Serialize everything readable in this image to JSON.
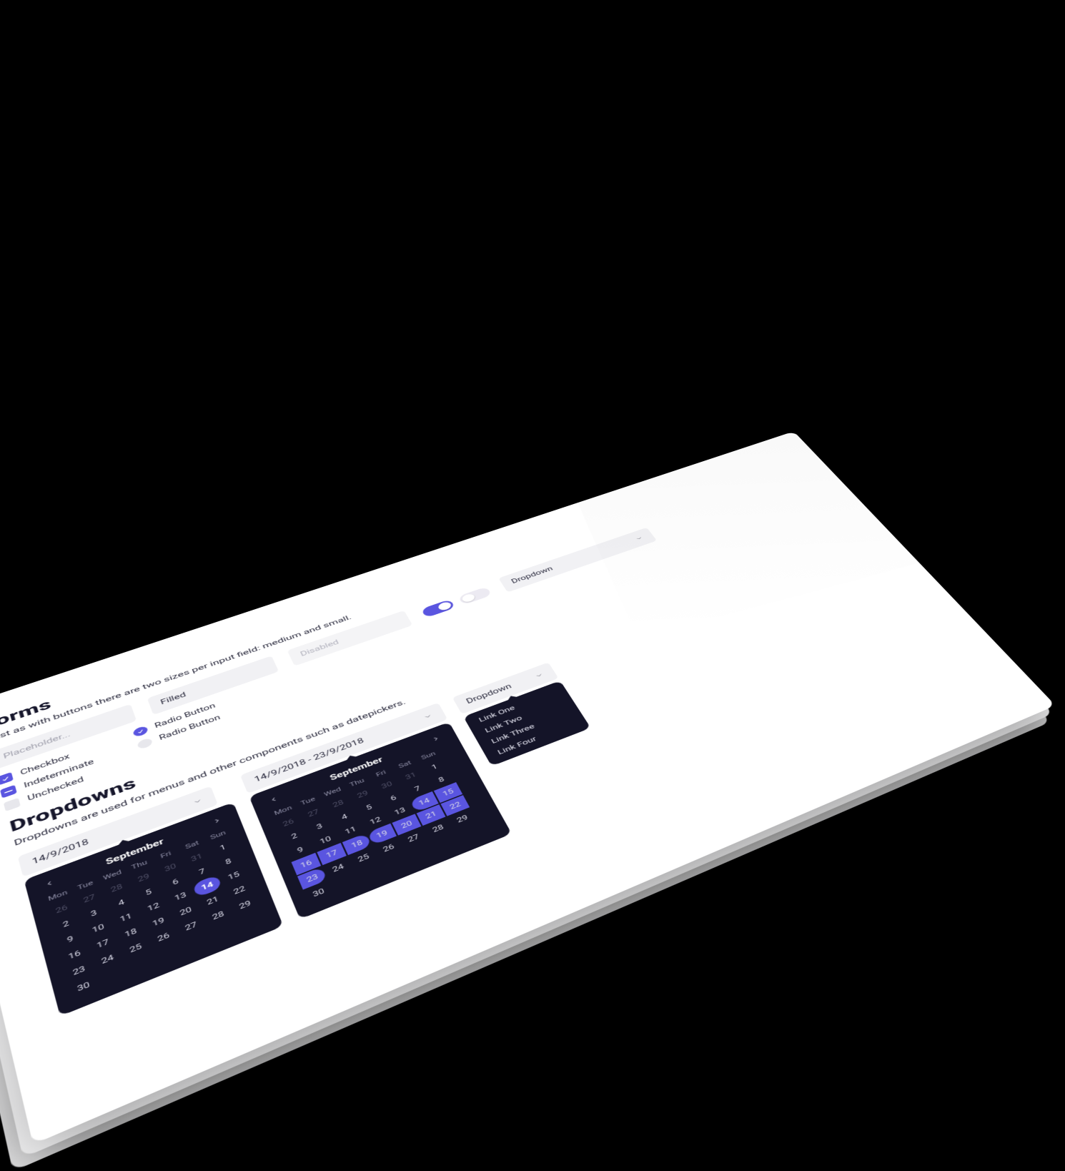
{
  "forms": {
    "title": "Forms",
    "subtitle": "Just as with buttons there are two sizes per input field: medium and small.",
    "placeholder": "Placeholder...",
    "filled": "Filled",
    "disabled": "Disabled",
    "dropdown_label": "Dropdown",
    "checkboxes": {
      "checked": "Checkbox",
      "indeterminate": "Indeterminate",
      "unchecked": "Unchecked"
    },
    "radios": {
      "on": "Radio Button",
      "off": "Radio Button"
    },
    "toggles": {
      "on": true,
      "off": false
    }
  },
  "dropdowns": {
    "title": "Dropdowns",
    "subtitle": "Dropdowns are used for menus and other components such as datepickers.",
    "single_date": "14/9/2018",
    "range_date": "14/9/2018 - 23/9/2018",
    "menu_label": "Dropdown",
    "menu_items": [
      "Link One",
      "Link Two",
      "Link Three",
      "Link Four"
    ]
  },
  "calendar": {
    "month": "September",
    "dow": [
      "Mon",
      "Tue",
      "Wed",
      "Thu",
      "Fri",
      "Sat",
      "Sun"
    ],
    "single": {
      "leading_out": [
        "26",
        "27",
        "28",
        "29",
        "30",
        "31"
      ],
      "days": [
        "1",
        "2",
        "3",
        "4",
        "5",
        "6",
        "7",
        "8",
        "9",
        "10",
        "11",
        "12",
        "13",
        "14",
        "15",
        "16",
        "17",
        "18",
        "19",
        "20",
        "21",
        "22",
        "23",
        "24",
        "25",
        "26",
        "27",
        "28",
        "29",
        "30"
      ],
      "selected": "14"
    },
    "range": {
      "leading_out": [
        "26",
        "27",
        "28",
        "29",
        "30",
        "31"
      ],
      "days": [
        "1",
        "2",
        "3",
        "4",
        "5",
        "6",
        "7",
        "8",
        "9",
        "10",
        "11",
        "12",
        "13",
        "14",
        "15",
        "16",
        "17",
        "18",
        "19",
        "20",
        "21",
        "22",
        "23",
        "24",
        "25",
        "26",
        "27",
        "28",
        "29",
        "30"
      ],
      "start": "14",
      "end": "23"
    }
  },
  "colors": {
    "accent": "#5a55e0",
    "surface_dark": "#141428",
    "input_bg": "#f1f1f4"
  }
}
